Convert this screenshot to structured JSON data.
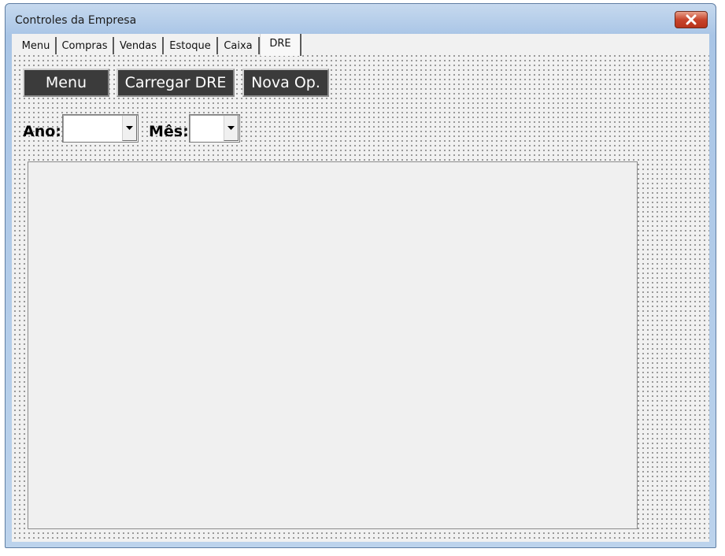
{
  "window": {
    "title": "Controles da Empresa"
  },
  "tabs": [
    {
      "label": "Menu"
    },
    {
      "label": "Compras"
    },
    {
      "label": "Vendas"
    },
    {
      "label": "Estoque"
    },
    {
      "label": "Caixa"
    },
    {
      "label": "DRE",
      "active": true
    }
  ],
  "toolbar": {
    "menu_label": "Menu",
    "load_label": "Carregar DRE",
    "new_op_label": "Nova Op."
  },
  "filters": {
    "year_label": "Ano:",
    "year_value": "",
    "month_label": "Mês:",
    "month_value": ""
  },
  "list": {
    "items": []
  },
  "colors": {
    "button_bg": "#3b3b3b",
    "button_text": "#ffffff",
    "close_button": "#c8452c",
    "form_bg": "#f1f1f1"
  },
  "icons": {
    "close": "close-icon",
    "dropdown": "chevron-down-icon"
  }
}
